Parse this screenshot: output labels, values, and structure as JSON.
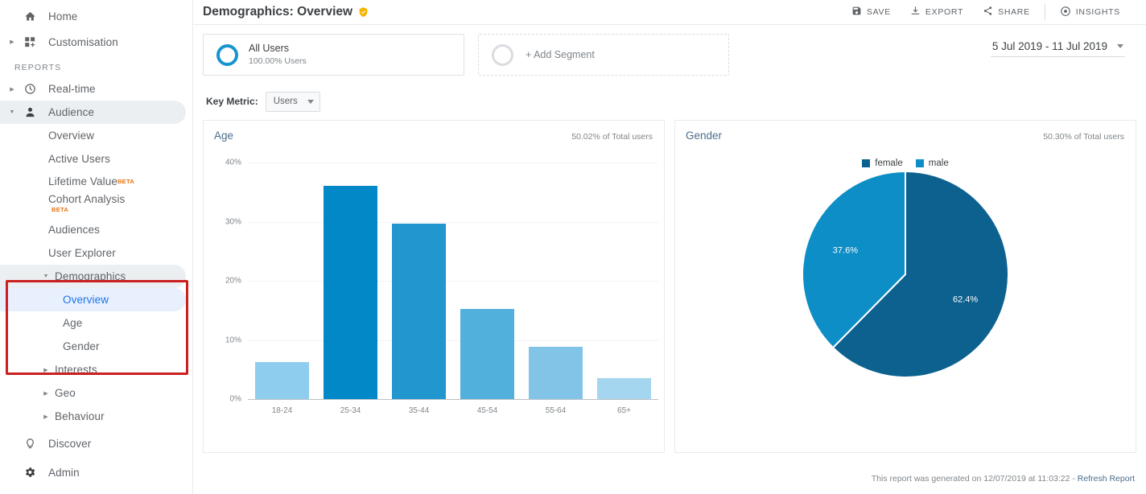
{
  "sidebar": {
    "top_items": [
      {
        "label": "Home",
        "icon": "home-icon",
        "arrow": false
      },
      {
        "label": "Customisation",
        "icon": "customisation-icon",
        "arrow": true
      }
    ],
    "section_label": "REPORTS",
    "reports": [
      {
        "label": "Real-time",
        "icon": "clock-icon",
        "arrow": true
      },
      {
        "label": "Audience",
        "icon": "person-icon",
        "arrow": true,
        "expanded": true,
        "selected_parent": true
      }
    ],
    "audience_children": [
      {
        "label": "Overview"
      },
      {
        "label": "Active Users"
      },
      {
        "label": "Lifetime Value",
        "beta": "BETA",
        "beta_pos": "sup"
      },
      {
        "label": "Cohort Analysis",
        "beta": "BETA",
        "beta_pos": "below"
      },
      {
        "label": "Audiences"
      },
      {
        "label": "User Explorer"
      }
    ],
    "demographics": {
      "label": "Demographics",
      "expanded": true
    },
    "demographics_children": [
      {
        "label": "Overview",
        "selected": true
      },
      {
        "label": "Age"
      },
      {
        "label": "Gender"
      }
    ],
    "after_demographics": [
      {
        "label": "Interests",
        "arrow": true
      },
      {
        "label": "Geo",
        "arrow": true
      },
      {
        "label": "Behaviour",
        "arrow": true
      }
    ],
    "bottom_items": [
      {
        "label": "Discover",
        "icon": "lightbulb-icon"
      },
      {
        "label": "Admin",
        "icon": "gear-icon"
      }
    ],
    "highlight_color": "#cc1f1f"
  },
  "header": {
    "title": "Demographics: Overview",
    "verified_icon": "shield-check-icon",
    "actions": [
      {
        "label": "SAVE",
        "icon": "save-icon"
      },
      {
        "label": "EXPORT",
        "icon": "export-icon"
      },
      {
        "label": "SHARE",
        "icon": "share-icon"
      },
      {
        "label": "INSIGHTS",
        "icon": "insights-icon"
      }
    ]
  },
  "segments": {
    "all_users": {
      "name": "All Users",
      "sub": "100.00% Users"
    },
    "add_segment": "+ Add Segment"
  },
  "date_range": "5 Jul 2019 - 11 Jul 2019",
  "key_metric": {
    "label": "Key Metric:",
    "value": "Users"
  },
  "age_panel": {
    "title": "Age",
    "total": "50.02% of Total users"
  },
  "gender_panel": {
    "title": "Gender",
    "total": "50.30% of Total users"
  },
  "footer": {
    "text": "This report was generated on 12/07/2019 at 11:03:22 - ",
    "link": "Refresh Report"
  },
  "chart_data": [
    {
      "type": "bar",
      "title": "Age",
      "xlabel": "",
      "ylabel": "",
      "ylim": [
        0,
        40
      ],
      "yticks": [
        "0%",
        "10%",
        "20%",
        "30%",
        "40%"
      ],
      "ytick_values": [
        0,
        10,
        20,
        30,
        40
      ],
      "grid": true,
      "categories": [
        "18-24",
        "25-34",
        "35-44",
        "45-54",
        "55-64",
        "65+"
      ],
      "values": [
        6.3,
        36.1,
        29.7,
        15.2,
        8.8,
        3.5
      ],
      "colors": [
        "#8ecdee",
        "#0288c7",
        "#2196cf",
        "#52b0dd",
        "#81c4e8",
        "#a5d6ef"
      ],
      "legend": "none"
    },
    {
      "type": "pie",
      "title": "Gender",
      "labels": [
        "female",
        "male"
      ],
      "values": [
        62.4,
        37.6
      ],
      "value_labels": [
        "62.4%",
        "37.6%"
      ],
      "colors": [
        "#0d618f",
        "#0d8ec6"
      ],
      "legend": "top"
    }
  ]
}
